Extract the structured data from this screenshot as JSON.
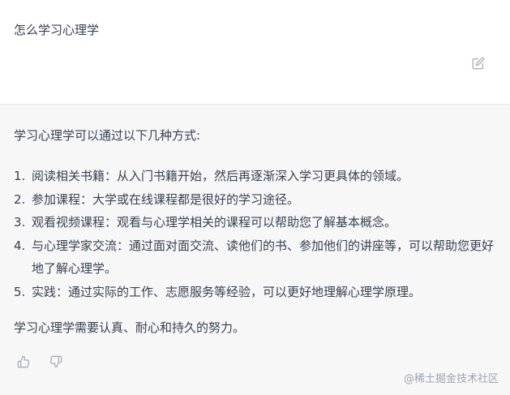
{
  "user_message": {
    "text": "怎么学习心理学"
  },
  "assistant_message": {
    "intro": "学习心理学可以通过以下几种方式:",
    "steps": [
      {
        "num": "1.",
        "text": "阅读相关书籍：从入门书籍开始，然后再逐渐深入学习更具体的领域。"
      },
      {
        "num": "2.",
        "text": "参加课程：大学或在线课程都是很好的学习途径。"
      },
      {
        "num": "3.",
        "text": "观看视频课程：观看与心理学相关的课程可以帮助您了解基本概念。"
      },
      {
        "num": "4.",
        "text": "与心理学家交流：通过面对面交流、读他们的书、参加他们的讲座等，可以帮助您更好地了解心理学。"
      },
      {
        "num": "5.",
        "text": "实践：通过实际的工作、志愿服务等经验，可以更好地理解心理学原理。"
      }
    ],
    "closing": "学习心理学需要认真、耐心和持久的努力。"
  },
  "watermark": "@稀土掘金技术社区",
  "icons": {
    "edit": "edit-icon",
    "thumbs_up": "thumbs-up-icon",
    "thumbs_down": "thumbs-down-icon"
  },
  "colors": {
    "text": "#374151",
    "icon": "#acacbe",
    "assistant_bg": "#f7f7f8",
    "watermark": "#9ca3af"
  }
}
